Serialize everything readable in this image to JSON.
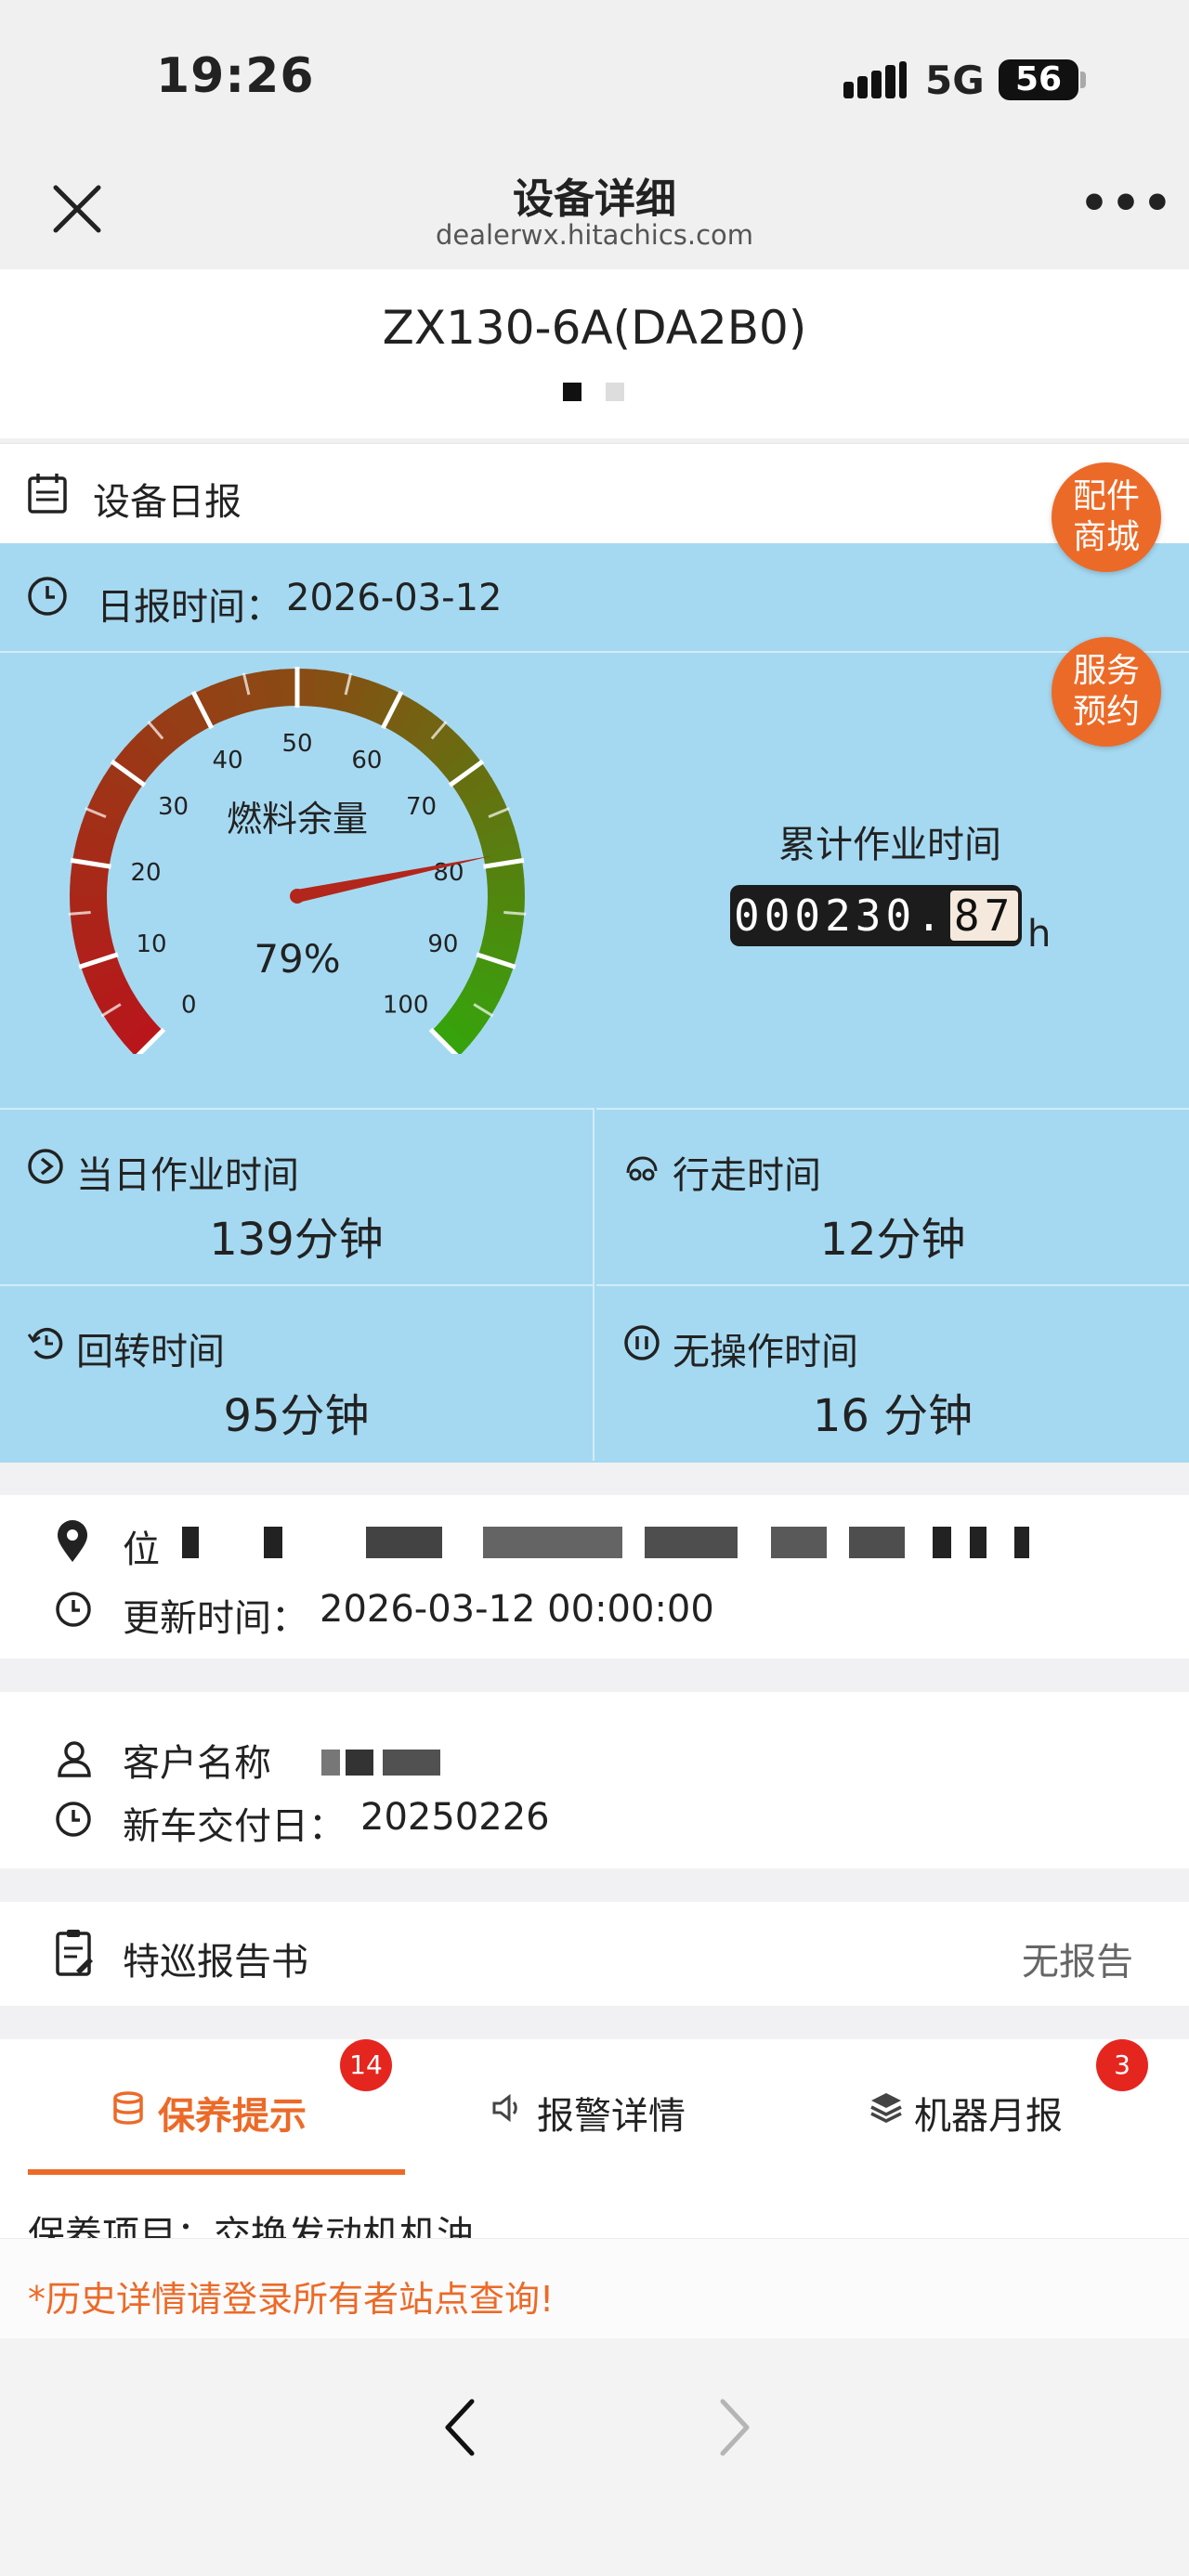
{
  "status_bar": {
    "time": "19:26",
    "network": "5G",
    "battery": "56"
  },
  "navbar": {
    "title": "设备详细",
    "domain": "dealerwx.hitachics.com",
    "close_icon": "close-icon",
    "more_icon": "more-icon"
  },
  "device": {
    "model": "ZX130-6A(DA2B0)"
  },
  "daily_report": {
    "header": "设备日报",
    "date_label": "日报时间：",
    "date": "2026-03-12",
    "gauge": {
      "title": "燃料余量",
      "value_text": "79%",
      "value": 79,
      "min": 0,
      "max": 100,
      "ticks": [
        "0",
        "10",
        "20",
        "30",
        "40",
        "50",
        "60",
        "70",
        "80",
        "90",
        "100"
      ],
      "colors": {
        "low": "#b8161b",
        "mid": "#8a4b14",
        "high": "#36a30c"
      }
    },
    "hours": {
      "title": "累计作业时间",
      "integer": "000230.",
      "decimal": "87",
      "unit": "h"
    },
    "stats": [
      {
        "label": "当日作业时间",
        "value": "139分钟",
        "icon": "play-clock-icon"
      },
      {
        "label": "行走时间",
        "value": "12分钟",
        "icon": "travel-icon"
      },
      {
        "label": "回转时间",
        "value": "95分钟",
        "icon": "swing-icon"
      },
      {
        "label": "无操作时间",
        "value": "16 分钟",
        "icon": "pause-icon"
      }
    ]
  },
  "float_buttons": {
    "parts_mall": "配件商城",
    "service_booking": "服务预约"
  },
  "location": {
    "prefix": "位",
    "update_label": "更新时间：",
    "update_value": "2026-03-12 00:00:00"
  },
  "customer": {
    "name_label": "客户名称",
    "delivery_label": "新车交付日：",
    "delivery_value": "20250226"
  },
  "inspection": {
    "label": "特巡报告书",
    "value": "无报告"
  },
  "tabs": [
    {
      "label": "保养提示",
      "badge": "14",
      "icon": "database-icon"
    },
    {
      "label": "报警详情",
      "badge": "",
      "icon": "speaker-icon"
    },
    {
      "label": "机器月报",
      "badge": "3",
      "icon": "layers-icon"
    }
  ],
  "maintenance": {
    "item": "保养项目：交换发动机机油"
  },
  "history_note": "*历史详情请登录所有者站点查询!",
  "colors": {
    "accent": "#ec6a28",
    "panel": "#a5d9f1",
    "badge": "#e5261f"
  }
}
